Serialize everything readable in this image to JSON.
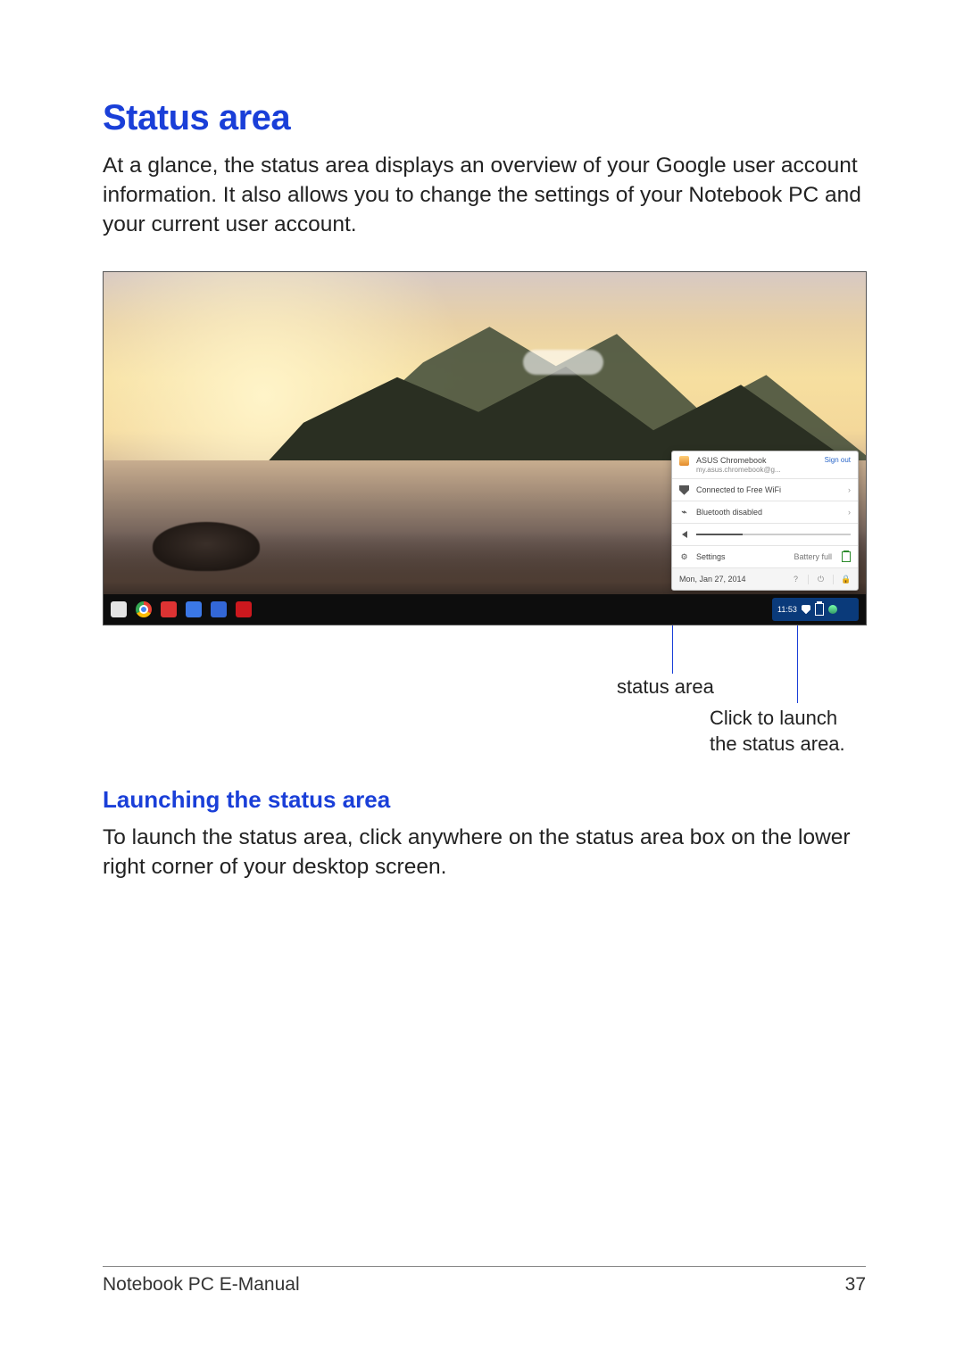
{
  "page": {
    "title": "Status area",
    "intro": "At a glance, the status area displays an overview of your Google user account information. It also allows you to change the settings of your Notebook PC and your current user account.",
    "sub_title": "Launching the status area",
    "sub_body": "To launch the status area, click anywhere on the status area box on the lower right corner of your desktop screen.",
    "footer_left": "Notebook PC E-Manual",
    "footer_right": "37"
  },
  "callouts": {
    "status_area": "status area",
    "click_launch": "Click to launch\nthe status area."
  },
  "screenshot": {
    "tray": {
      "time": "11:53"
    },
    "panel": {
      "account_name": "ASUS Chromebook",
      "account_email": "my.asus.chromebook@g...",
      "sign_out": "Sign out",
      "wifi": "Connected to Free WiFi",
      "bluetooth": "Bluetooth disabled",
      "settings": "Settings",
      "battery": "Battery full",
      "date": "Mon, Jan 27, 2014"
    }
  }
}
